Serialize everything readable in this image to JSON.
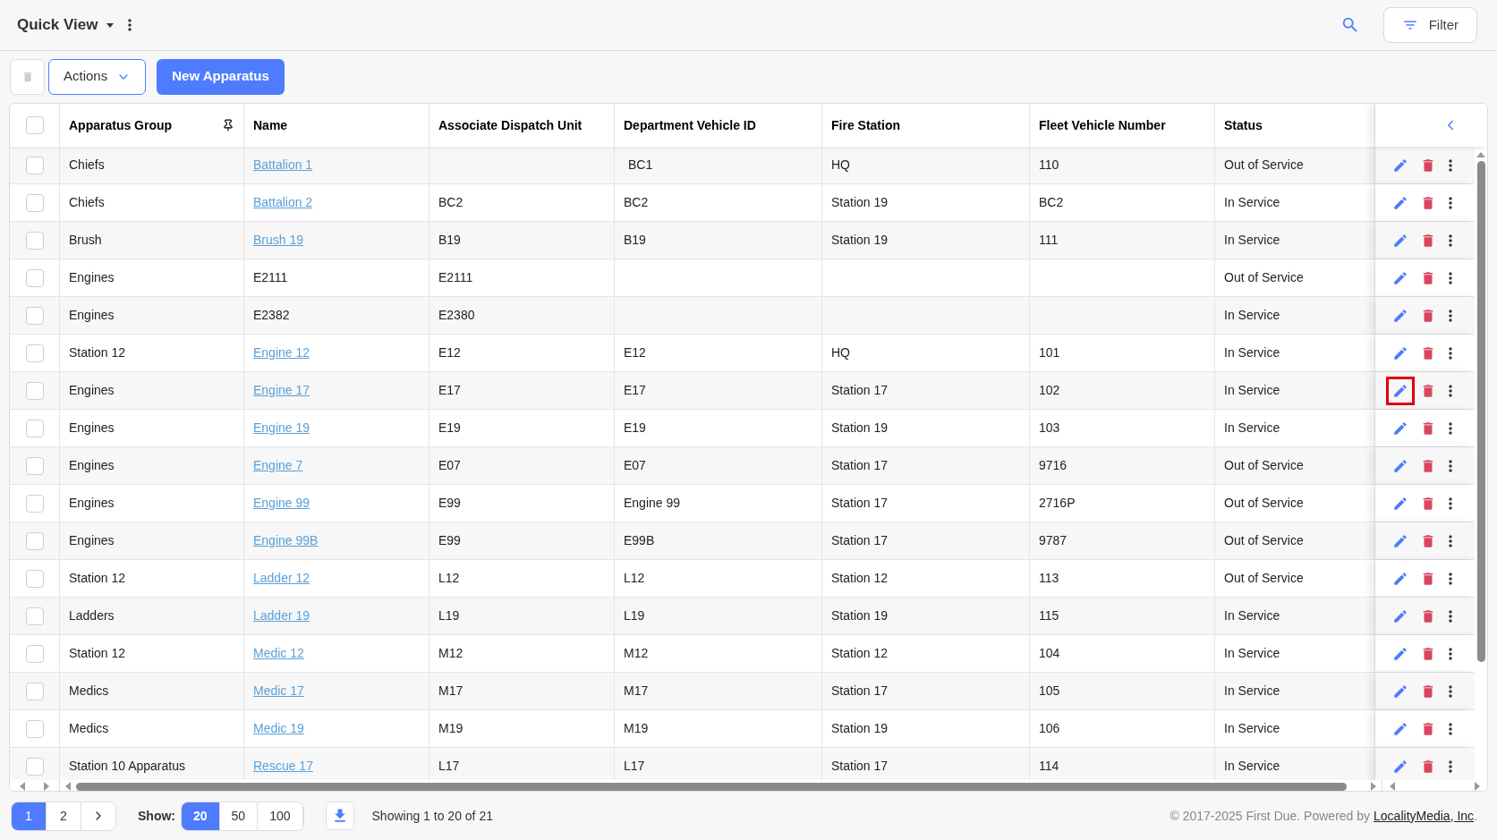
{
  "header": {
    "title": "Quick View",
    "filter_label": "Filter"
  },
  "toolbar": {
    "actions_label": "Actions",
    "new_label": "New Apparatus"
  },
  "table": {
    "select_all_checked": false,
    "columns": [
      "Apparatus Group",
      "Name",
      "Associate Dispatch Unit",
      "Department Vehicle ID",
      "Fire Station",
      "Fleet Vehicle Number",
      "Status"
    ],
    "rows": [
      {
        "checked": false,
        "group": "Chiefs",
        "name": "Battalion 1",
        "link": true,
        "dispatch_unit": "",
        "vehicle_id": "BC1",
        "station": "HQ",
        "fleet_number": "110",
        "status": "Out of Service",
        "highlighted": false
      },
      {
        "checked": false,
        "group": "Chiefs",
        "name": "Battalion 2",
        "link": true,
        "dispatch_unit": "BC2",
        "vehicle_id": "BC2",
        "station": "Station 19",
        "fleet_number": "BC2",
        "status": "In Service",
        "highlighted": false
      },
      {
        "checked": false,
        "group": "Brush",
        "name": "Brush 19",
        "link": true,
        "dispatch_unit": "B19",
        "vehicle_id": "B19",
        "station": "Station 19",
        "fleet_number": "111",
        "status": "In Service",
        "highlighted": false
      },
      {
        "checked": false,
        "group": "Engines",
        "name": "E2111",
        "link": false,
        "dispatch_unit": "E2111",
        "vehicle_id": "",
        "station": "",
        "fleet_number": "",
        "status": "Out of Service",
        "highlighted": false
      },
      {
        "checked": false,
        "group": "Engines",
        "name": "E2382",
        "link": false,
        "dispatch_unit": "E2380",
        "vehicle_id": "",
        "station": "",
        "fleet_number": "",
        "status": "In Service",
        "highlighted": false
      },
      {
        "checked": false,
        "group": "Station 12",
        "name": "Engine 12",
        "link": true,
        "dispatch_unit": "E12",
        "vehicle_id": "E12",
        "station": "HQ",
        "fleet_number": "101",
        "status": "In Service",
        "highlighted": false
      },
      {
        "checked": false,
        "group": "Engines",
        "name": "Engine 17",
        "link": true,
        "dispatch_unit": "E17",
        "vehicle_id": "E17",
        "station": "Station 17",
        "fleet_number": "102",
        "status": "In Service",
        "highlighted": true
      },
      {
        "checked": false,
        "group": "Engines",
        "name": "Engine 19",
        "link": true,
        "dispatch_unit": "E19",
        "vehicle_id": "E19",
        "station": "Station 19",
        "fleet_number": "103",
        "status": "In Service",
        "highlighted": false
      },
      {
        "checked": false,
        "group": "Engines",
        "name": "Engine 7",
        "link": true,
        "dispatch_unit": "E07",
        "vehicle_id": "E07",
        "station": "Station 17",
        "fleet_number": "9716",
        "status": "Out of Service",
        "highlighted": false
      },
      {
        "checked": false,
        "group": "Engines",
        "name": "Engine 99",
        "link": true,
        "dispatch_unit": "E99",
        "vehicle_id": "Engine 99",
        "station": "Station 17",
        "fleet_number": "2716P",
        "status": "Out of Service",
        "highlighted": false
      },
      {
        "checked": false,
        "group": "Engines",
        "name": "Engine 99B",
        "link": true,
        "dispatch_unit": "E99",
        "vehicle_id": "E99B",
        "station": "Station 17",
        "fleet_number": "9787",
        "status": "Out of Service",
        "highlighted": false
      },
      {
        "checked": false,
        "group": "Station 12",
        "name": "Ladder 12",
        "link": true,
        "dispatch_unit": "L12",
        "vehicle_id": "L12",
        "station": "Station 12",
        "fleet_number": "113",
        "status": "Out of Service",
        "highlighted": false
      },
      {
        "checked": false,
        "group": "Ladders",
        "name": "Ladder 19",
        "link": true,
        "dispatch_unit": "L19",
        "vehicle_id": "L19",
        "station": "Station 19",
        "fleet_number": "115",
        "status": "In Service",
        "highlighted": false
      },
      {
        "checked": false,
        "group": "Station 12",
        "name": "Medic 12",
        "link": true,
        "dispatch_unit": "M12",
        "vehicle_id": "M12",
        "station": "Station 12",
        "fleet_number": "104",
        "status": "In Service",
        "highlighted": false
      },
      {
        "checked": false,
        "group": "Medics",
        "name": "Medic 17",
        "link": true,
        "dispatch_unit": "M17",
        "vehicle_id": "M17",
        "station": "Station 17",
        "fleet_number": "105",
        "status": "In Service",
        "highlighted": false
      },
      {
        "checked": false,
        "group": "Medics",
        "name": "Medic 19",
        "link": true,
        "dispatch_unit": "M19",
        "vehicle_id": "M19",
        "station": "Station 19",
        "fleet_number": "106",
        "status": "In Service",
        "highlighted": false
      },
      {
        "checked": false,
        "group": "Station 10 Apparatus",
        "name": "Rescue 17",
        "link": true,
        "dispatch_unit": "L17",
        "vehicle_id": "L17",
        "station": "Station 17",
        "fleet_number": "114",
        "status": "In Service",
        "highlighted": false
      }
    ]
  },
  "footer": {
    "pages": [
      {
        "label": "1",
        "selected": true
      },
      {
        "label": "2",
        "selected": false
      }
    ],
    "show_label": "Show:",
    "page_sizes": [
      {
        "label": "20",
        "selected": true
      },
      {
        "label": "50",
        "selected": false
      },
      {
        "label": "100",
        "selected": false
      }
    ],
    "summary": "Showing 1 to 20 of 21",
    "copyright": "© 2017-2025 First Due. Powered by",
    "powered_link": "LocalityMedia, Inc",
    "period": "."
  }
}
